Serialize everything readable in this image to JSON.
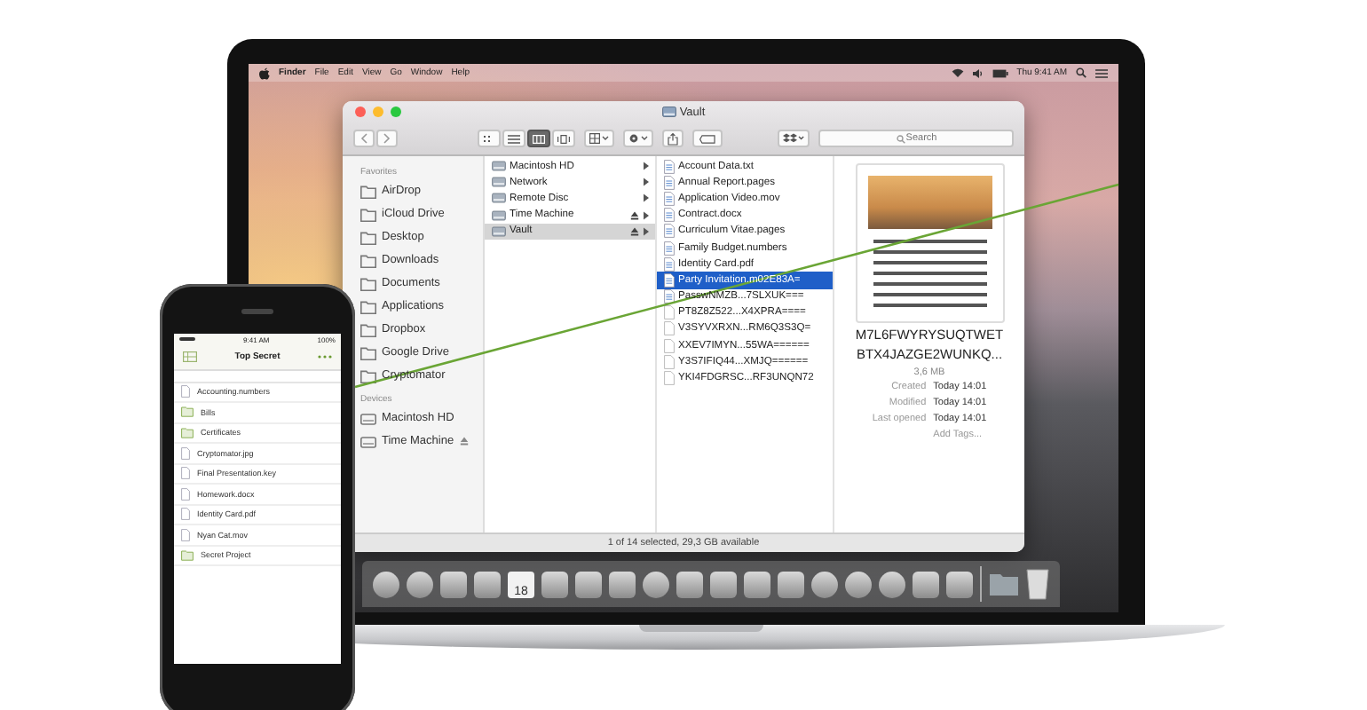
{
  "menu_bar": {
    "items": [
      "Finder",
      "File",
      "Edit",
      "View",
      "Go",
      "Window",
      "Help"
    ],
    "clock": "Thu 9:41 AM"
  },
  "finder": {
    "title": "Vault",
    "view_modes": [
      {
        "selected": false
      },
      {
        "selected": false
      },
      {
        "selected": true
      },
      {
        "selected": false
      }
    ],
    "search": {
      "placeholder": "Search"
    },
    "sidebar": [
      {
        "title": "Favorites",
        "items": [
          {
            "label": "AirDrop",
            "selected": false,
            "ejectable": false
          },
          {
            "label": "iCloud Drive",
            "selected": false,
            "ejectable": false
          },
          {
            "label": "Desktop",
            "selected": false,
            "ejectable": false
          },
          {
            "label": "Downloads",
            "selected": false,
            "ejectable": false
          },
          {
            "label": "Documents",
            "selected": false,
            "ejectable": false
          },
          {
            "label": "Applications",
            "selected": false,
            "ejectable": false
          },
          {
            "label": "Dropbox",
            "selected": false,
            "ejectable": false
          },
          {
            "label": "Google Drive",
            "selected": false,
            "ejectable": false
          },
          {
            "label": "Cryptomator",
            "selected": false,
            "ejectable": false
          }
        ]
      },
      {
        "title": "Devices",
        "items": [
          {
            "label": "Macintosh HD",
            "selected": false,
            "ejectable": false
          },
          {
            "label": "Time Machine",
            "selected": false,
            "ejectable": true
          }
        ]
      }
    ],
    "columns": [
      {
        "rows": [
          {
            "label": "Macintosh HD",
            "kind": "disk",
            "selected": false,
            "expandable": true,
            "ejectable": false
          },
          {
            "label": "Network",
            "kind": "disk",
            "selected": false,
            "expandable": true,
            "ejectable": false
          },
          {
            "label": "Remote Disc",
            "kind": "disk",
            "selected": false,
            "expandable": true,
            "ejectable": false
          },
          {
            "label": "Time Machine",
            "kind": "disk",
            "selected": false,
            "expandable": true,
            "ejectable": true
          },
          {
            "label": "Vault",
            "kind": "disk",
            "selected": true,
            "expandable": true,
            "ejectable": true
          }
        ]
      },
      {
        "rows": [
          {
            "label": "Account Data.txt",
            "kind": "document",
            "selected": false,
            "expandable": false,
            "ejectable": false
          },
          {
            "label": "Annual Report.pages",
            "kind": "document",
            "selected": false,
            "expandable": false,
            "ejectable": false
          },
          {
            "label": "Application Video.mov",
            "kind": "document",
            "selected": false,
            "expandable": false,
            "ejectable": false
          },
          {
            "label": "Contract.docx",
            "kind": "document",
            "selected": false,
            "expandable": false,
            "ejectable": false
          },
          {
            "label": "Curriculum Vitae.pages",
            "kind": "document",
            "selected": false,
            "expandable": false,
            "ejectable": false
          },
          {
            "label": "Family Budget.numbers",
            "kind": "document",
            "selected": false,
            "expandable": false,
            "ejectable": false
          },
          {
            "label": "Identity Card.pdf",
            "kind": "document",
            "selected": false,
            "expandable": false,
            "ejectable": false
          },
          {
            "label": "Party Invitation.m02E83A=",
            "kind": "document",
            "selected": true,
            "expandable": false,
            "ejectable": false
          },
          {
            "label": "PasswNMZB...7SLXUK===",
            "kind": "document",
            "selected": false,
            "expandable": false,
            "ejectable": false
          },
          {
            "label": "PT8Z8Z522...X4XPRA====",
            "kind": "encrypted",
            "selected": false,
            "expandable": false,
            "ejectable": false
          },
          {
            "label": "V3SYVXRXN...RM6Q3S3Q=",
            "kind": "encrypted",
            "selected": false,
            "expandable": false,
            "ejectable": false
          },
          {
            "label": "XXEV7IMYN...55WA======",
            "kind": "encrypted",
            "selected": false,
            "expandable": false,
            "ejectable": false
          },
          {
            "label": "Y3S7IFIQ44...XMJQ======",
            "kind": "encrypted",
            "selected": false,
            "expandable": false,
            "ejectable": false
          },
          {
            "label": "YKI4FDGRSC...RF3UNQN72",
            "kind": "encrypted",
            "selected": false,
            "expandable": false,
            "ejectable": false
          }
        ]
      }
    ],
    "preview": {
      "name_lines": [
        "M7L6FWYRYSUQTWET",
        "BTX4JAZGE2WUNKQ..."
      ],
      "size": "3,6 MB",
      "details": [
        {
          "label": "Created",
          "value": "Today 14:01"
        },
        {
          "label": "Modified",
          "value": "Today 14:01"
        },
        {
          "label": "Last opened",
          "value": "Today 14:01"
        }
      ],
      "add_tags": "Add Tags..."
    },
    "status_bar": "1 of 14 selected, 29,3 GB available"
  },
  "dock": {
    "calendar_date": "18"
  },
  "phone": {
    "time": "9:41 AM",
    "battery": "100%",
    "title": "Top Secret",
    "items": [
      {
        "name": "Accounting.numbers",
        "kind": "file"
      },
      {
        "name": "Bills",
        "kind": "folder"
      },
      {
        "name": "Certificates",
        "kind": "folder"
      },
      {
        "name": "Cryptomator.jpg",
        "kind": "file"
      },
      {
        "name": "Final Presentation.key",
        "kind": "file"
      },
      {
        "name": "Homework.docx",
        "kind": "file"
      },
      {
        "name": "Identity Card.pdf",
        "kind": "file"
      },
      {
        "name": "Nyan Cat.mov",
        "kind": "file"
      },
      {
        "name": "Secret Project",
        "kind": "folder"
      }
    ]
  }
}
